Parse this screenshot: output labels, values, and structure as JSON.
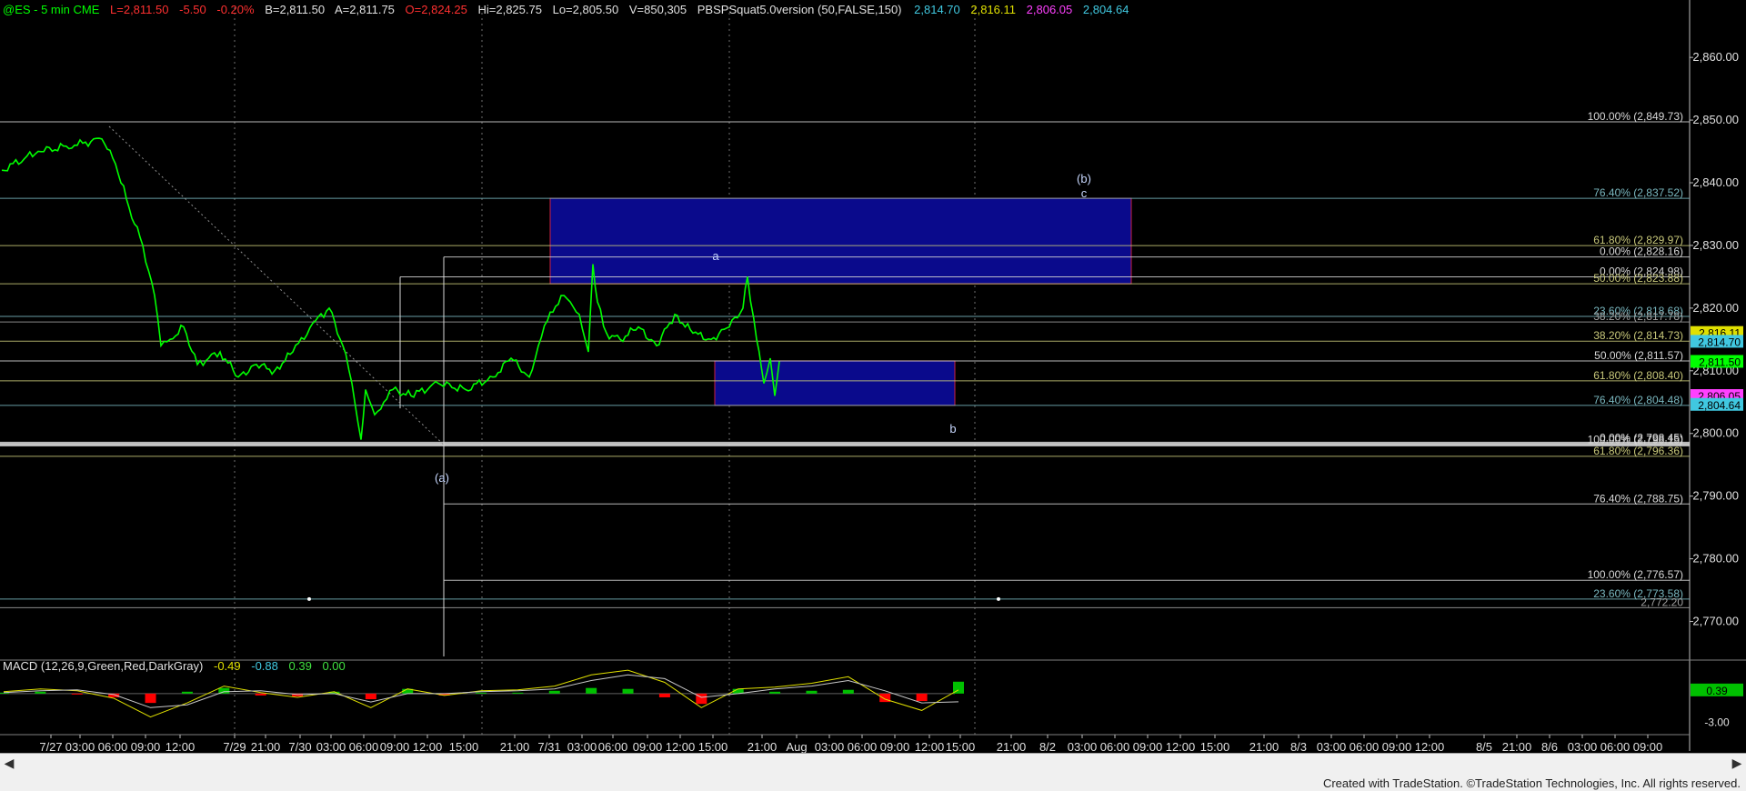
{
  "header": {
    "symbol": "@ES - 5 min  CME",
    "last": "L=2,811.50",
    "change": "-5.50",
    "change_pct": "-0.20%",
    "bid": "B=2,811.50",
    "ask": "A=2,811.75",
    "open": "O=2,824.25",
    "high": "Hi=2,825.75",
    "low": "Lo=2,805.50",
    "volume": "V=850,305",
    "indicator": "PBSPSquat5.0version (50,FALSE,150)",
    "v1": "2,814.70",
    "v2": "2,816.11",
    "v3": "2,806.05",
    "v4": "2,804.64"
  },
  "macd_header": {
    "title": "MACD (12,26,9,Green,Red,DarkGray)",
    "macd": "-0.49",
    "avg": "-0.88",
    "diff": "0.39",
    "zero": "0.00"
  },
  "colors": {
    "price": "#00ff00",
    "blue_box": "#0a0a8c",
    "box_border": "#cc2244",
    "level_white": "#d8d8d8",
    "level_teal": "#7ab8c0",
    "level_olive": "#c8c87a",
    "level_gray": "#a0a0a0",
    "macd_up": "#00c000",
    "macd_down": "#ff0000",
    "signal": "#c8c8c8"
  },
  "chart_data": {
    "type": "line",
    "title": "@ES - 5 min CME",
    "ylim": [
      2765,
      2868
    ],
    "y_ticks": [
      "2,860.00",
      "2,850.00",
      "2,840.00",
      "2,830.00",
      "2,820.00",
      "2,810.00",
      "2,800.00",
      "2,790.00",
      "2,780.00",
      "2,770.00"
    ],
    "x_tick_labels": [
      "7/27",
      "03:00",
      "06:00",
      "09:00",
      "12:00",
      "7/29",
      "21:00",
      "7/30",
      "03:00",
      "06:00",
      "09:00",
      "12:00",
      "15:00",
      "21:00",
      "7/31",
      "03:00",
      "06:00",
      "09:00",
      "12:00",
      "15:00",
      "21:00",
      "Aug",
      "03:00",
      "06:00",
      "09:00",
      "12:00",
      "15:00",
      "21:00",
      "8/2",
      "03:00",
      "06:00",
      "09:00",
      "12:00",
      "15:00",
      "21:00",
      "8/3",
      "03:00",
      "06:00",
      "09:00",
      "12:00",
      "8/5",
      "21:00",
      "8/6",
      "03:00",
      "06:00",
      "09:00"
    ],
    "price_series": {
      "name": "@ES",
      "x": [
        0,
        40,
        80,
        110,
        125,
        140,
        155,
        168,
        175,
        185,
        200,
        215,
        240,
        260,
        280,
        300,
        320,
        345,
        360,
        375,
        385,
        395,
        400,
        410,
        420,
        430,
        450,
        480,
        510,
        540,
        560,
        580,
        590,
        600,
        615,
        625,
        635,
        645,
        650,
        655,
        665,
        680,
        700,
        720,
        740,
        760,
        780,
        800,
        815,
        820,
        830,
        838,
        845,
        850,
        855
      ],
      "y": [
        2842,
        2845,
        2846,
        2847,
        2843,
        2836,
        2830,
        2822,
        2814,
        2815,
        2817,
        2811,
        2813,
        2809,
        2811,
        2810,
        2813,
        2818,
        2820,
        2814,
        2808,
        2799,
        2807,
        2803,
        2805,
        2807,
        2806,
        2808,
        2807,
        2809,
        2812,
        2809,
        2814,
        2818,
        2822,
        2821,
        2819,
        2813,
        2827,
        2821,
        2816,
        2815,
        2817,
        2814,
        2819,
        2816,
        2815,
        2817,
        2820,
        2825,
        2815,
        2808,
        2812,
        2806,
        2811.5
      ]
    },
    "price_levels": [
      {
        "label": "100.00% (2,849.73)",
        "value": 2849.73
      },
      {
        "label": "76.40% (2,837.52)",
        "value": 2837.52
      },
      {
        "label": "61.80% (2,829.97)",
        "value": 2829.97
      },
      {
        "label": "0.00% (2,828.16)",
        "value": 2828.16
      },
      {
        "label": "0.00% (2,824.98)",
        "value": 2824.98
      },
      {
        "label": "50.00% (2,823.88)",
        "value": 2823.88
      },
      {
        "label": "23.60% (2,818.68)",
        "value": 2818.68
      },
      {
        "label": "38.20% (2,817.78)",
        "value": 2817.78
      },
      {
        "label": "38.20% (2,814.73)",
        "value": 2814.73
      },
      {
        "label": "50.00% (2,811.57)",
        "value": 2811.57
      },
      {
        "label": "61.80% (2,808.40)",
        "value": 2808.4
      },
      {
        "label": "76.40% (2,804.48)",
        "value": 2804.48
      },
      {
        "label": "100.00% (2,798.15)",
        "value": 2798.15
      },
      {
        "label": "0.00% (2,798.45)",
        "value": 2798.45
      },
      {
        "label": "61.80% (2,796.36)",
        "value": 2796.36
      },
      {
        "label": "76.40% (2,788.75)",
        "value": 2788.75
      },
      {
        "label": "100.00% (2,776.57)",
        "value": 2776.57
      },
      {
        "label": "23.60% (2,773.58)",
        "value": 2773.58
      },
      {
        "label": "2,772.20",
        "value": 2772.2
      }
    ],
    "price_tags": [
      {
        "label": "2,816.11",
        "value": 2816.11
      },
      {
        "label": "2,814.70",
        "value": 2814.7
      },
      {
        "label": "2,811.50",
        "value": 2811.5
      },
      {
        "label": "2,806.05",
        "value": 2806.05
      },
      {
        "label": "2,804.64",
        "value": 2804.64
      }
    ],
    "boxes": [
      {
        "top": 2837.52,
        "bottom": 2823.88
      },
      {
        "top": 2811.57,
        "bottom": 2804.48
      }
    ],
    "wave_labels": [
      "(a)",
      "a",
      "b",
      "(b)",
      "c"
    ],
    "macd": {
      "ylim": [
        -4,
        3
      ],
      "y_ticks": [
        "0.39",
        "-3.00"
      ],
      "macd_values": [
        0.2,
        0.5,
        0.3,
        -0.5,
        -2.5,
        -1.0,
        0.8,
        0.1,
        -0.4,
        0.2,
        -1.5,
        0.5,
        -0.2,
        0.3,
        0.4,
        0.8,
        2.0,
        2.5,
        1.2,
        -1.5,
        0.5,
        0.7,
        1.1,
        1.8,
        -0.6,
        -1.8,
        0.39
      ],
      "signal_values": [
        0.1,
        0.3,
        0.4,
        -0.1,
        -1.5,
        -1.2,
        0.2,
        0.3,
        -0.1,
        0.0,
        -0.9,
        0.0,
        0.0,
        0.2,
        0.3,
        0.5,
        1.4,
        2.0,
        1.6,
        -0.4,
        0.0,
        0.5,
        0.8,
        1.4,
        0.3,
        -1.0,
        -0.88
      ]
    }
  },
  "footer": {
    "text": "Created with TradeStation. ©TradeStation Technologies, Inc. All rights reserved."
  }
}
